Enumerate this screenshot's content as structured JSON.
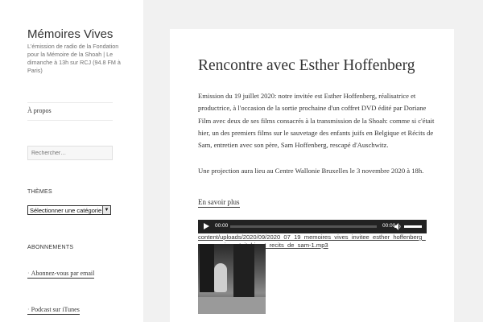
{
  "site": {
    "title": "Mémoires Vives",
    "description": "L'émission de radio de la Fondation pour la Mémoire de la Shoah | Le dimanche à 13h sur RCJ (94.8 FM à Paris)"
  },
  "nav": {
    "items": [
      {
        "label": "À propos"
      }
    ]
  },
  "search": {
    "placeholder": "Rechercher…"
  },
  "widgets": {
    "themes": {
      "title": "THÈMES",
      "select_value": "Sélectionner une catégorie"
    },
    "subscriptions": {
      "title": "ABONNEMENTS",
      "links": [
        "Abonnez-vous par email",
        "Podcast sur iTunes"
      ]
    }
  },
  "post": {
    "title": "Rencontre avec Esther Hoffenberg",
    "paragraphs": [
      "Emission du 19 juillet 2020: notre invitée est Esther Hoffenberg, réalisatrice et productrice, à l'occasion de la sortie prochaine d'un coffret DVD édité par Doriane Film avec deux de ses films consacrés à la transmission de la Shoah: comme si c'était hier, un des premiers films sur le sauvetage des enfants juifs en Belgique et Récits de Sam, entretien avec son père, Sam Hoffenberg, rescapé d'Auschwitz.",
      "Une projection aura lieu au Centre Wallonie Bruxelles le 3 novembre 2020 à 18h."
    ],
    "more_link": "En savoir plus",
    "audio": {
      "current_time": "00:00",
      "duration": "00:00"
    },
    "file_url": "content/uploads/2020/09/2020_07_19_memoires_vives_invitee_esther_hoffenberg_comme_si_c_etait_hieret_recits_de_sam-1.mp3"
  },
  "colors": {
    "background": "#f1f1f1",
    "panel": "#ffffff",
    "text": "#333333",
    "player": "#222222"
  }
}
